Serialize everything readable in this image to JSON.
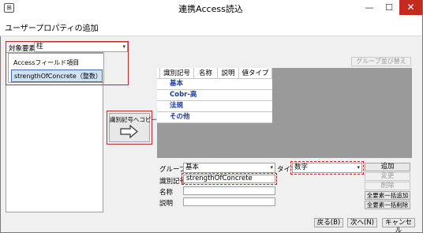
{
  "window": {
    "title": "連携Access読込",
    "app_icon": "database-icon",
    "close_glyph": "✕",
    "min_glyph": "—",
    "max_glyph": "☐"
  },
  "header": {
    "text": "ユーザープロパティの追加"
  },
  "left": {
    "target_label": "対象要素",
    "target_value": "柱",
    "field_list_title": "Accessフィールド項目",
    "field_item": "strengthOfConcrete（整数）"
  },
  "copy_button": {
    "label": "識別記号へコピー",
    "icon": "arrow-right-icon"
  },
  "right": {
    "group_reorder_button": "グループ並び替え",
    "grid": {
      "columns": [
        "識別記号",
        "名称",
        "説明",
        "値タイプ"
      ],
      "rows": [
        "基本",
        "Cobr-高",
        "法規",
        "その他"
      ]
    },
    "form": {
      "group_label": "グループ",
      "group_value": "基本",
      "type_label": "タイプ",
      "type_value": "数字",
      "id_label": "識別記号",
      "id_value": "strengthOfConcrete",
      "name_label": "名称",
      "desc_label": "説明"
    },
    "buttons": {
      "add": "追加",
      "change": "変更",
      "delete": "削除",
      "add_all": "全要素一括追加",
      "delete_all": "全要素一括削除"
    }
  },
  "footer": {
    "back": "戻る(B)",
    "next": "次へ(N)",
    "cancel": "キャンセル"
  },
  "colors": {
    "accent_red": "#c0282d",
    "row_text": "#1a3c9a",
    "close_red": "#c42b1c"
  }
}
